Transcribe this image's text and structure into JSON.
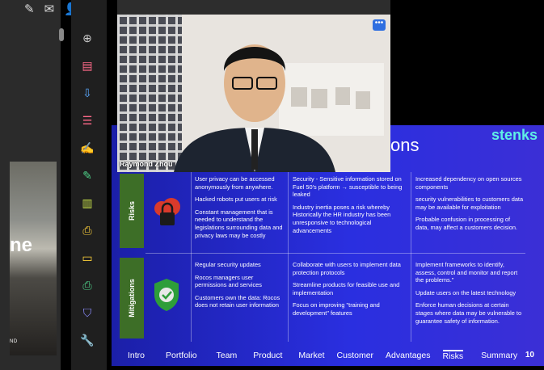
{
  "left_app": {
    "photo_text": "ne",
    "photo_small": "ND"
  },
  "toolbar": {
    "icons": [
      "edit-sign-icon",
      "mail-icon",
      "add-user-icon",
      "zoom-in-icon",
      "create-pdf-icon",
      "export-pdf-icon",
      "organize-pages-icon",
      "fill-sign-icon",
      "edit-pdf-icon",
      "compress-icon",
      "export-icon",
      "comment-icon",
      "print-icon",
      "protect-icon",
      "tools-icon"
    ]
  },
  "video": {
    "name": "Raymond Zhou",
    "more_label": "•••"
  },
  "slide": {
    "title": "ons",
    "logo": "stenks",
    "rows": [
      {
        "label": "Risks",
        "col1": [
          "User privacy can be accessed anonymously from anywhere.",
          "Hacked robots put users at risk",
          "Constant management that is needed to understand the legislations surrounding data and privacy laws may be costly"
        ],
        "col2": [
          "Security - Sensitive information stored on Fuel 50's platform → susceptible to being leaked",
          "Industry inertia poses a risk whereby Historically the HR industry has been unresponsive to technological advancements"
        ],
        "col3": [
          "Increased dependency on open sources components",
          "security vulnerabilities to customers data may be available for exploitation",
          "Probable confusion in processing of data, may affect a customers decision."
        ]
      },
      {
        "label": "Mitigations",
        "col1": [
          "Regular security updates",
          "Rocos managers user permissions and services",
          "Customers own the data: Rocos does not retain user information"
        ],
        "col2": [
          "Collaborate with users to implement data protection protocols",
          "Streamline products for feasible use and implementation",
          "Focus on improving \"training and development\" features"
        ],
        "col3": [
          "Implement frameworks to identify, assess, control and monitor and report the problems.\"",
          "Update users on the latest technology",
          "Enforce human decisions at certain stages where data may be vulnerable to guarantee safety of information."
        ]
      }
    ],
    "nav": [
      "Intro",
      "Portfolio",
      "Team",
      "Product",
      "Market",
      "Customer",
      "Advantages",
      "Risks",
      "Summary"
    ],
    "page": "10"
  }
}
